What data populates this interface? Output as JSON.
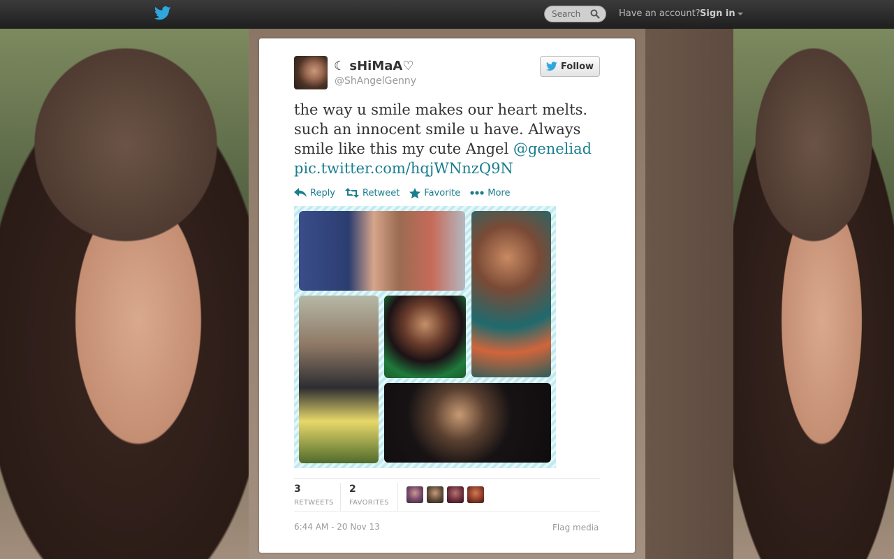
{
  "topbar": {
    "search": {
      "placeholder": "Search"
    },
    "have_account": "Have an account?",
    "sign_in": "Sign in"
  },
  "tweet": {
    "display_name": "☾ sHiMaA♡",
    "screen_name": "@ShAngelGenny",
    "follow_label": "Follow",
    "text_main": "the way u smile makes our heart melts. such an innocent smile u have. Always smile like this my cute Angel ",
    "mention": "@geneliad",
    "pic_link": "pic.twitter.com/hqjWNnzQ9N",
    "actions": {
      "reply": "Reply",
      "retweet": "Retweet",
      "favorite": "Favorite",
      "more": "More"
    },
    "stats": {
      "retweets_count": "3",
      "retweets_label": "RETWEETS",
      "favorites_count": "2",
      "favorites_label": "FAVORITES"
    },
    "timestamp": "6:44 AM - 20 Nov 13",
    "flag_media": "Flag media"
  },
  "colors": {
    "link": "#1a7e8f",
    "topbar": "#2a2a2a",
    "twitter_blue": "#2fa6de"
  },
  "icons": [
    "twitter-bird-icon",
    "search-icon",
    "reply-icon",
    "retweet-icon",
    "favorite-star-icon",
    "more-dots-icon"
  ]
}
